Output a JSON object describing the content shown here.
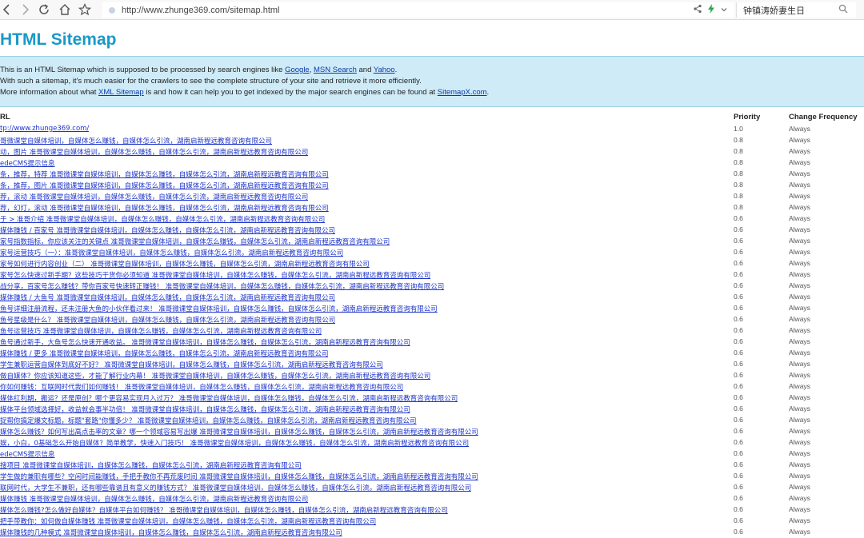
{
  "browser": {
    "url": "http://www.zhunge369.com/sitemap.html",
    "search_query": "钟镇涛娇妻生日"
  },
  "page": {
    "title": "HTML Sitemap",
    "intro": {
      "line1_prefix": "This is an HTML Sitemap which is supposed to be processed by search engines like ",
      "link_google": "Google",
      "sep1": ", ",
      "link_msn": "MSN Search",
      "sep2": " and ",
      "link_yahoo": "Yahoo",
      "line1_suffix": ".",
      "line2": "With such a sitemap, it's much easier for the crawlers to see the complete structure of your site and retrieve it more efficiently.",
      "line3_prefix": "More information about what ",
      "link_xml": "XML Sitemap",
      "line3_mid": " is and how it can help you to get indexed by the major search engines can be found at ",
      "link_sitemapx": "SitemapX.com",
      "line3_suffix": "."
    },
    "table": {
      "headers": {
        "url": "RL",
        "priority": "Priority",
        "freq": "Change Frequency"
      },
      "rows": [
        {
          "url": "tp://www.zhunge369.com/",
          "priority": "1.0",
          "freq": "Always"
        },
        {
          "url": "哥微课堂自媒体培训，自媒体怎么赚钱，自媒体怎么引流，湖南启新程远教育咨询有限公司",
          "priority": "0.8",
          "freq": "Always"
        },
        {
          "url": "动，图片 准哥微课堂自媒体培训，自媒体怎么赚钱，自媒体怎么引流，湖南启新程远教育咨询有限公司",
          "priority": "0.8",
          "freq": "Always"
        },
        {
          "url": "edeCMS提示信息",
          "priority": "0.8",
          "freq": "Always"
        },
        {
          "url": "条，推荐，特荐 准哥微课堂自媒体培训，自媒体怎么赚钱，自媒体怎么引流，湖南启新程远教育咨询有限公司",
          "priority": "0.8",
          "freq": "Always"
        },
        {
          "url": "条，推荐，图片 准哥微课堂自媒体培训，自媒体怎么赚钱，自媒体怎么引流，湖南启新程远教育咨询有限公司",
          "priority": "0.8",
          "freq": "Always"
        },
        {
          "url": "荐，滚动 准哥微课堂自媒体培训，自媒体怎么赚钱，自媒体怎么引流，湖南启新程远教育咨询有限公司",
          "priority": "0.8",
          "freq": "Always"
        },
        {
          "url": "荐，幻灯，滚动 准哥微课堂自媒体培训，自媒体怎么赚钱，自媒体怎么引流，湖南启新程远教育咨询有限公司",
          "priority": "0.8",
          "freq": "Always"
        },
        {
          "url": "于 > 准哥介绍 准哥微课堂自媒体培训，自媒体怎么赚钱，自媒体怎么引流，湖南启新程远教育咨询有限公司",
          "priority": "0.6",
          "freq": "Always"
        },
        {
          "url": "媒体赚钱 / 百家号 准哥微课堂自媒体培训，自媒体怎么赚钱，自媒体怎么引流，湖南启新程远教育咨询有限公司",
          "priority": "0.6",
          "freq": "Always"
        },
        {
          "url": "家号指数指标，你应该关注的关键点 准哥微课堂自媒体培训，自媒体怎么赚钱，自媒体怎么引流，湖南启新程远教育咨询有限公司",
          "priority": "0.6",
          "freq": "Always"
        },
        {
          "url": "家号运营技巧（一）：准哥微课堂自媒体培训，自媒体怎么赚钱，自媒体怎么引流，湖南启新程远教育咨询有限公司",
          "priority": "0.6",
          "freq": "Always"
        },
        {
          "url": "家号如何进行内容创业（二） 准哥微课堂自媒体培训，自媒体怎么赚钱，自媒体怎么引流，湖南启新程远教育咨询有限公司",
          "priority": "0.6",
          "freq": "Always"
        },
        {
          "url": "家号怎么快速过新手期？这些技巧干货你必须知道 准哥微课堂自媒体培训，自媒体怎么赚钱，自媒体怎么引流，湖南启新程远教育咨询有限公司",
          "priority": "0.6",
          "freq": "Always"
        },
        {
          "url": "战分享，百家号怎么赚钱？带你百家号快速转正赚钱！ 准哥微课堂自媒体培训，自媒体怎么赚钱，自媒体怎么引流，湖南启新程远教育咨询有限公司",
          "priority": "0.6",
          "freq": "Always"
        },
        {
          "url": "媒体赚钱 / 大鱼号 准哥微课堂自媒体培训，自媒体怎么赚钱，自媒体怎么引流，湖南启新程远教育咨询有限公司",
          "priority": "0.6",
          "freq": "Always"
        },
        {
          "url": "鱼号详细注册流程，还未注册大鱼的小伙伴看过来！ 准哥微课堂自媒体培训，自媒体怎么赚钱，自媒体怎么引流，湖南启新程远教育咨询有限公司",
          "priority": "0.6",
          "freq": "Always"
        },
        {
          "url": "鱼号星级是什么？ 准哥微课堂自媒体培训，自媒体怎么赚钱，自媒体怎么引流，湖南启新程远教育咨询有限公司",
          "priority": "0.6",
          "freq": "Always"
        },
        {
          "url": "鱼号运营技巧 准哥微课堂自媒体培训，自媒体怎么赚钱，自媒体怎么引流，湖南启新程远教育咨询有限公司",
          "priority": "0.6",
          "freq": "Always"
        },
        {
          "url": "鱼号通过新手，大鱼号怎么快速开通收益。 准哥微课堂自媒体培训，自媒体怎么赚钱，自媒体怎么引流，湖南启新程远教育咨询有限公司",
          "priority": "0.6",
          "freq": "Always"
        },
        {
          "url": "媒体赚钱 / 更多 准哥微课堂自媒体培训，自媒体怎么赚钱，自媒体怎么引流，湖南启新程远教育咨询有限公司",
          "priority": "0.6",
          "freq": "Always"
        },
        {
          "url": "学生兼职运营自媒体到底好不好？ 准哥微课堂自媒体培训，自媒体怎么赚钱，自媒体怎么引流，湖南启新程远教育咨询有限公司",
          "priority": "0.6",
          "freq": "Always"
        },
        {
          "url": "做自媒体？你应该知道这些，才能了解行业内幕！ 准哥微课堂自媒体培训，自媒体怎么赚钱，自媒体怎么引流，湖南启新程远教育咨询有限公司",
          "priority": "0.6",
          "freq": "Always"
        },
        {
          "url": "你如何赚钱：互联网时代我们如何赚钱！ 准哥微课堂自媒体培训，自媒体怎么赚钱，自媒体怎么引流，湖南启新程远教育咨询有限公司",
          "priority": "0.6",
          "freq": "Always"
        },
        {
          "url": "媒体红利期，搬运？还是原创？哪个更容易实现月入过万？ 准哥微课堂自媒体培训，自媒体怎么赚钱，自媒体怎么引流，湖南启新程远教育咨询有限公司",
          "priority": "0.6",
          "freq": "Always"
        },
        {
          "url": "媒体平台领域选择好，收益就会事半功倍！ 准哥微课堂自媒体培训，自媒体怎么赚钱，自媒体怎么引流，湖南启新程远教育咨询有限公司",
          "priority": "0.6",
          "freq": "Always"
        },
        {
          "url": "捉帮你搞定爆文标题，标题\"套路\"你懂多少？ 准哥微课堂自媒体培训，自媒体怎么赚钱，自媒体怎么引流，湖南启新程远教育咨询有限公司",
          "priority": "0.6",
          "freq": "Always"
        },
        {
          "url": "媒体怎么赚钱？如何写出高点击率的文章？哪一个领域容易写出爆 准哥微课堂自媒体培训，自媒体怎么赚钱，自媒体怎么引流，湖南启新程远教育咨询有限公司",
          "priority": "0.6",
          "freq": "Always"
        },
        {
          "url": "娱，小白，0基础怎么开始自媒体？简单教学，快速入门技巧！ 准哥微课堂自媒体培训，自媒体怎么赚钱，自媒体怎么引流，湖南启新程远教育咨询有限公司",
          "priority": "0.6",
          "freq": "Always"
        },
        {
          "url": "edeCMS提示信息",
          "priority": "0.6",
          "freq": "Always"
        },
        {
          "url": "搜项目 准哥微课堂自媒体培训，自媒体怎么赚钱，自媒体怎么引流，湖南启新程远教育咨询有限公司",
          "priority": "0.6",
          "freq": "Always"
        },
        {
          "url": "学生做的兼职有哪些？空闲时间能赚钱，手把手教你不再荒废时间 准哥微课堂自媒体培训，自媒体怎么赚钱，自媒体怎么引流，湖南启新程远教育咨询有限公司",
          "priority": "0.6",
          "freq": "Always"
        },
        {
          "url": "联网时代，大学生不兼职，还有哪些靠谱且有意义的赚钱方式？ 准哥微课堂自媒体培训，自媒体怎么赚钱，自媒体怎么引流，湖南启新程远教育咨询有限公司",
          "priority": "0.6",
          "freq": "Always"
        },
        {
          "url": "媒体赚钱 准哥微课堂自媒体培训，自媒体怎么赚钱，自媒体怎么引流，湖南启新程远教育咨询有限公司",
          "priority": "0.6",
          "freq": "Always"
        },
        {
          "url": "媒体怎么赚钱?怎么做好自媒体？自媒体平台如何赚钱？ 准哥微课堂自媒体培训，自媒体怎么赚钱，自媒体怎么引流，湖南启新程远教育咨询有限公司",
          "priority": "0.6",
          "freq": "Always"
        },
        {
          "url": "把手带教你：如何做自媒体赚钱 准哥微课堂自媒体培训，自媒体怎么赚钱，自媒体怎么引流，湖南启新程远教育咨询有限公司",
          "priority": "0.6",
          "freq": "Always"
        },
        {
          "url": "媒体赚钱的几种模式 准哥微课堂自媒体培训，自媒体怎么赚钱，自媒体怎么引流，湖南启新程远教育咨询有限公司",
          "priority": "0.6",
          "freq": "Always"
        }
      ]
    }
  },
  "icons": {
    "back": "back-arrow-icon",
    "forward": "forward-arrow-icon",
    "reload": "reload-icon",
    "home": "home-icon",
    "star": "star-icon",
    "share": "share-icon",
    "bolt": "lightning-icon",
    "dropdown": "chevron-down-icon",
    "search": "search-icon"
  },
  "colors": {
    "title": "#1a99c7",
    "intro_bg": "#cfebf7",
    "link": "#1d34c9"
  }
}
